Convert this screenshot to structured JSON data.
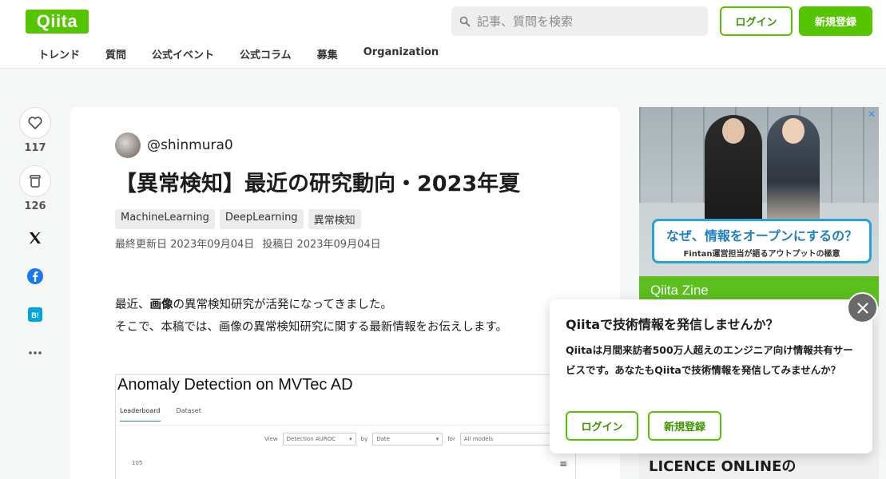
{
  "header": {
    "logo": "Qiita",
    "search_placeholder": "記事、質問を検索",
    "login": "ログイン",
    "signup": "新規登録",
    "nav": [
      "トレンド",
      "質問",
      "公式イベント",
      "公式コラム",
      "募集",
      "Organization"
    ]
  },
  "sidebar": {
    "like_count": "117",
    "stock_count": "126"
  },
  "article": {
    "author": "@shinmura0",
    "title": "【異常検知】最近の研究動向・2023年夏",
    "tags": [
      "MachineLearning",
      "DeepLearning",
      "異常検知"
    ],
    "updated": "最終更新日 2023年09月04日",
    "posted": "投稿日 2023年09月04日",
    "para1_pre": "最近、",
    "para1_bold": "画像",
    "para1_post": "の異常検知研究が活発になってきました。",
    "para2": "そこで、本稿では、画像の異常検知研究に関する最新情報をお伝えします。",
    "figure": {
      "title": "Anomaly Detection on MVTec AD",
      "tab_active": "Leaderboard",
      "tab_other": "Dataset",
      "view_label": "View",
      "view_value": "Detection AUROC",
      "by_label": "by",
      "by_value": "Date",
      "for_label": "for",
      "for_value": "All models",
      "y_tick": "105"
    }
  },
  "ad": {
    "headline": "なぜ、情報をオープンにするの？",
    "subline": "Fintan運営担当が語るアウトプットの極意",
    "footer": "Qiita Zine",
    "ad2_text": "LICENCE ONLINEの"
  },
  "popup": {
    "title": "Qiitaで技術情報を発信しませんか？",
    "body": "Qiitaは月間来訪者500万人超えのエンジニア向け情報共有サービスです。あなたもQiitaで技術情報を発信してみませんか？",
    "login": "ログイン",
    "signup": "新規登録"
  },
  "colors": {
    "brand": "#55c500",
    "background": "#f5f6f6"
  }
}
